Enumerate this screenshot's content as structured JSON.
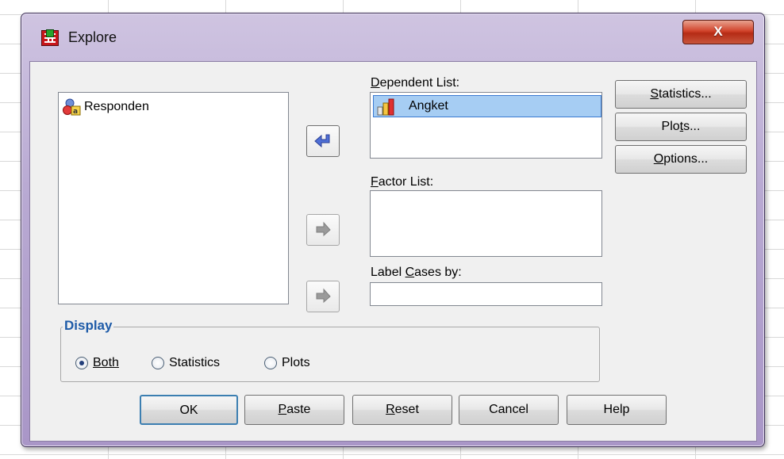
{
  "window": {
    "title": "Explore",
    "close_label": "X"
  },
  "source_list": {
    "items": [
      {
        "label": "Responden",
        "icon": "nominal-variable-icon"
      }
    ]
  },
  "dependent_list": {
    "label": "Dependent List:",
    "items": [
      {
        "label": "Angket",
        "icon": "scale-variable-icon",
        "selected": true
      }
    ]
  },
  "factor_list": {
    "label": "Factor List:",
    "items": []
  },
  "label_cases": {
    "label": "Label Cases by:",
    "value": ""
  },
  "side_buttons": {
    "statistics": "Statistics...",
    "plots": "Plots...",
    "options": "Options..."
  },
  "display": {
    "title": "Display",
    "options": [
      {
        "label": "Both",
        "checked": true
      },
      {
        "label": "Statistics",
        "checked": false
      },
      {
        "label": "Plots",
        "checked": false
      }
    ]
  },
  "bottom_buttons": {
    "ok": "OK",
    "paste": "Paste",
    "reset": "Reset",
    "cancel": "Cancel",
    "help": "Help"
  },
  "colors": {
    "title_bar": "#b9aad3",
    "close_button": "#c8412a",
    "selection": "#a6cdf3",
    "group_title": "#1e5ba8",
    "arrow_blue": "#4f6fd6"
  }
}
